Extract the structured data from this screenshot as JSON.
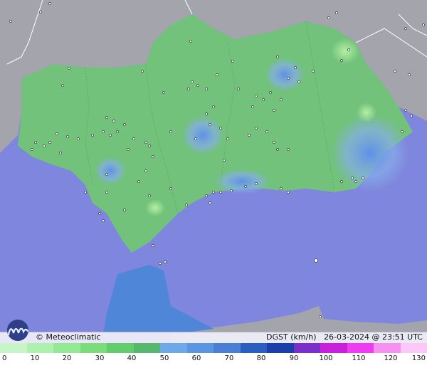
{
  "footer": {
    "brand": "© Meteoclimatic",
    "variable": "DGST (km/h)",
    "datetime": "26-03-2024 @ 23:51 UTC"
  },
  "scale": {
    "ticks": [
      "0",
      "10",
      "20",
      "30",
      "40",
      "50",
      "60",
      "70",
      "80",
      "90",
      "100",
      "110",
      "120",
      "130"
    ],
    "colors": [
      "#c8f5c8",
      "#aef0ae",
      "#95e895",
      "#7bdc7b",
      "#63cc6f",
      "#55b86e",
      "#6ea8e8",
      "#5a95e0",
      "#4a7fd4",
      "#2a5fbf",
      "#1a3fa8",
      "#7a2fc8",
      "#c81fd8",
      "#f03cf0",
      "#f890f0",
      "#fcc8f8"
    ]
  },
  "map": {
    "sea_color": "#7f86dd",
    "land_outside_color": "#a5a5ad",
    "region_color": "#72c27b"
  }
}
